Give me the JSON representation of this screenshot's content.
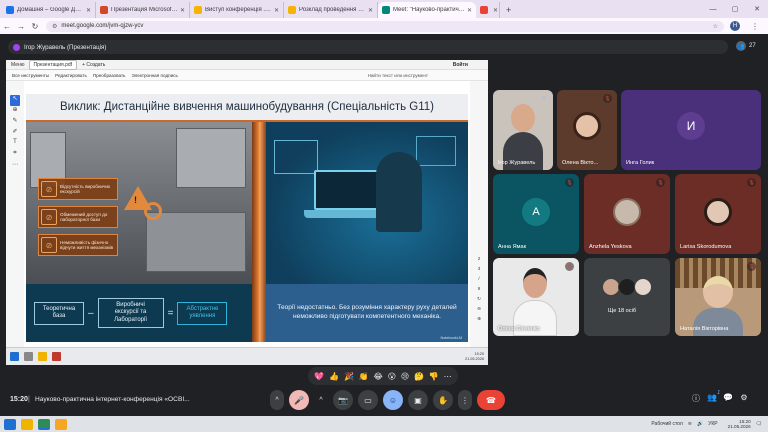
{
  "browser": {
    "tabs": [
      {
        "title": "Домашня – Google Диск",
        "favicon_color": "#1a73e8"
      },
      {
        "title": "Презентация Microsoft PowerPoint",
        "favicon_color": "#d24726"
      },
      {
        "title": "Виступ конференція .pptx - Google",
        "favicon_color": "#f4b400"
      },
      {
        "title": "Розклад проведення конференції",
        "favicon_color": "#f4b400"
      },
      {
        "title": "Meet: \"Науково-практична\"",
        "favicon_color": "#00897b",
        "active": true
      },
      {
        "title": "",
        "favicon_color": "#ea4335"
      }
    ],
    "new_tab": "+",
    "url": "meet.google.com/jvm-qjzw-ycv",
    "profile_initial": "H"
  },
  "meet": {
    "presenter_label": "Ігор Журавель (Презентація)",
    "people_count": "27",
    "time": "15:20",
    "separator": "|",
    "meeting_title": "Науково-практична інтернет-конференція «ОСВІ...",
    "reactions": [
      "💖",
      "👍",
      "🎉",
      "👏",
      "😂",
      "😮",
      "😢",
      "🤔",
      "👎",
      "⋯"
    ],
    "host_badge": "1"
  },
  "presentation": {
    "top_bar": {
      "menu": "Меню",
      "file_tab": "Презентация.pdf",
      "new_tab": "+ Создать",
      "signin": "Войти"
    },
    "menu": [
      "Все инструменты",
      "Редактировать",
      "Преобразовать",
      "Электронная подпись"
    ],
    "search": "Найти текст или инструмент",
    "page_numbers": [
      "2",
      "3",
      "/",
      "9"
    ],
    "taskbar_time": "15:20",
    "taskbar_date": "21.05.2026"
  },
  "slide": {
    "title": "Виклик: Дистанційне вивчення машинобудування (Спеціальність G11)",
    "warnings": [
      "Відсутність виробничих екскурсій",
      "Обмежений доступ до лабораторної бази",
      "Неможливість фізично відчути життя механізмів"
    ],
    "formula": {
      "a": "Теоретична база",
      "op1": "–",
      "b": "Виробничі екскурсії та Лабораторії",
      "op2": "=",
      "c": "Абстрактне уявлення"
    },
    "theory_text": "Теорії недостатньо. Без розуміння характеру руху деталей неможливо підготувати компетентного механіка.",
    "notebook_mark": "NotebookLM"
  },
  "participants": [
    {
      "name": "Ігор Журавель",
      "type": "video",
      "bg": "#c9c3bb",
      "muted": false,
      "speaking": true
    },
    {
      "name": "Олена Вікто...",
      "type": "video",
      "bg": "#5d3b2c",
      "muted": true
    },
    {
      "name": "Инга Голик",
      "type": "avatar",
      "initial": "И",
      "bg": "#4a2f7a",
      "avatar_color": "#5c3d8f",
      "muted": false
    },
    {
      "name": "Анна Ямак",
      "type": "avatar",
      "initial": "А",
      "bg": "#0b5563",
      "avatar_color": "#137a82",
      "muted": true
    },
    {
      "name": "Anzhela Yeskova",
      "type": "photo",
      "bg": "#6b2d25",
      "muted": true
    },
    {
      "name": "Larisa Skorodumova",
      "type": "photo",
      "bg": "#6b2d25",
      "muted": true
    },
    {
      "name": "Олена Сінченко",
      "type": "video",
      "bg": "#e9e9ea",
      "muted": true
    },
    {
      "name": "Ще 18 осіб",
      "type": "more",
      "bg": "#3c4043",
      "muted": false
    },
    {
      "name": "Наталія Вікторівна",
      "type": "video",
      "bg": "#b89a7a",
      "muted": true
    }
  ],
  "controls": {
    "raise": "^",
    "mic": "🎤",
    "camera": "📷",
    "present": "▭",
    "emoji": "☺",
    "captions": "▣",
    "hand": "✋",
    "more": "⋮",
    "end": "☎"
  },
  "windows": {
    "tray_lang": "УКР",
    "tray_time": "15:20",
    "tray_date": "21.05.2026",
    "desktop_label": "Рабочий стол"
  }
}
